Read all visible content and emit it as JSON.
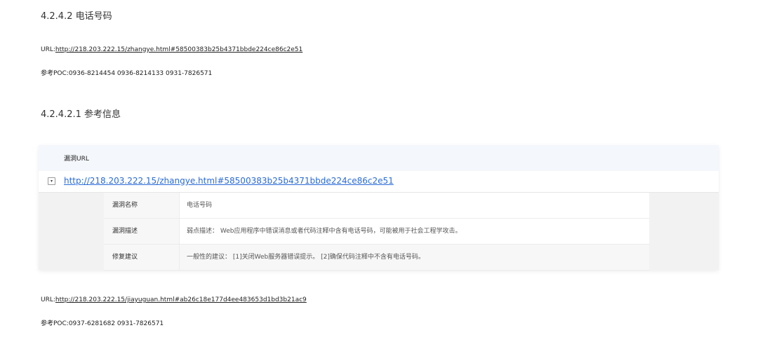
{
  "section1": {
    "title": "4.2.4.2 电话号码",
    "url_label": "URL:",
    "url": "http://218.203.222.15/zhangye.html#58500383b25b4371bbde224ce86c2e51",
    "poc": "参考POC:0936-8214454 0936-8214133 0931-7826571"
  },
  "section2": {
    "title": "4.2.4.2.1 参考信息"
  },
  "card": {
    "header": "漏洞URL",
    "toggle_icon": "▾",
    "url": "http://218.203.222.15/zhangye.html#58500383b25b4371bbde224ce86c2e51",
    "rows": [
      {
        "key": "漏洞名称",
        "value": "电话号码"
      },
      {
        "key": "漏洞描述",
        "value": "弱点描述： Web应用程序中错误消息或者代码注释中含有电话号码，可能被用于社会工程学攻击。"
      },
      {
        "key": "修复建议",
        "value": "一般性的建议： [1]关闭Web服务器错误提示。 [2]确保代码注释中不含有电话号码。"
      }
    ]
  },
  "section3": {
    "url_label": "URL:",
    "url": "http://218.203.222.15/jiayuguan.html#ab26c18e177d4ee483653d1bd3b21ac9",
    "poc": "参考POC:0937-6281682 0931-7826571"
  }
}
